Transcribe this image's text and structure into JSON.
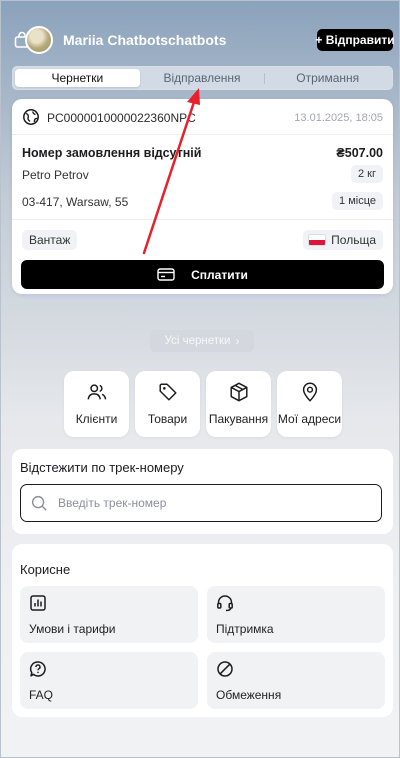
{
  "header": {
    "user_name": "Mariia Chatbotschatbots",
    "send_button": "+ Відправити"
  },
  "tabs": [
    {
      "label": "Чернетки",
      "active": true
    },
    {
      "label": "Відправлення",
      "active": false
    },
    {
      "label": "Отримання",
      "active": false
    }
  ],
  "order": {
    "id": "PC0000010000022360NPC",
    "date": "13.01.2025, 18:05",
    "number_label": "Номер замовлення відсутній",
    "price": "₴507.00",
    "recipient": "Petro Petrov",
    "weight": "2 кг",
    "address": "03-417, Warsaw, 55",
    "places": "1 місце",
    "type": "Вантаж",
    "country": "Польща",
    "pay_button": "Сплатити"
  },
  "all_drafts": "Усі чернетки",
  "quick_actions": [
    {
      "label": "Клієнти",
      "icon": "users-icon"
    },
    {
      "label": "Товари",
      "icon": "tag-icon"
    },
    {
      "label": "Пакування",
      "icon": "box-icon"
    },
    {
      "label": "Мої адреси",
      "icon": "map-pin-icon"
    }
  ],
  "tracking": {
    "title": "Відстежити по трек-номеру",
    "placeholder": "Введіть трек-номер"
  },
  "useful": {
    "title": "Корисне",
    "items": [
      {
        "label": "Умови і тарифи",
        "icon": "chart-document-icon"
      },
      {
        "label": "Підтримка",
        "icon": "headset-icon"
      },
      {
        "label": "FAQ",
        "icon": "question-bubble-icon"
      },
      {
        "label": "Обмеження",
        "icon": "prohibited-icon"
      }
    ]
  },
  "colors": {
    "primary": "#000000",
    "annotation_arrow": "#e8202a",
    "header_gradient_top": "#8aa2bb"
  }
}
